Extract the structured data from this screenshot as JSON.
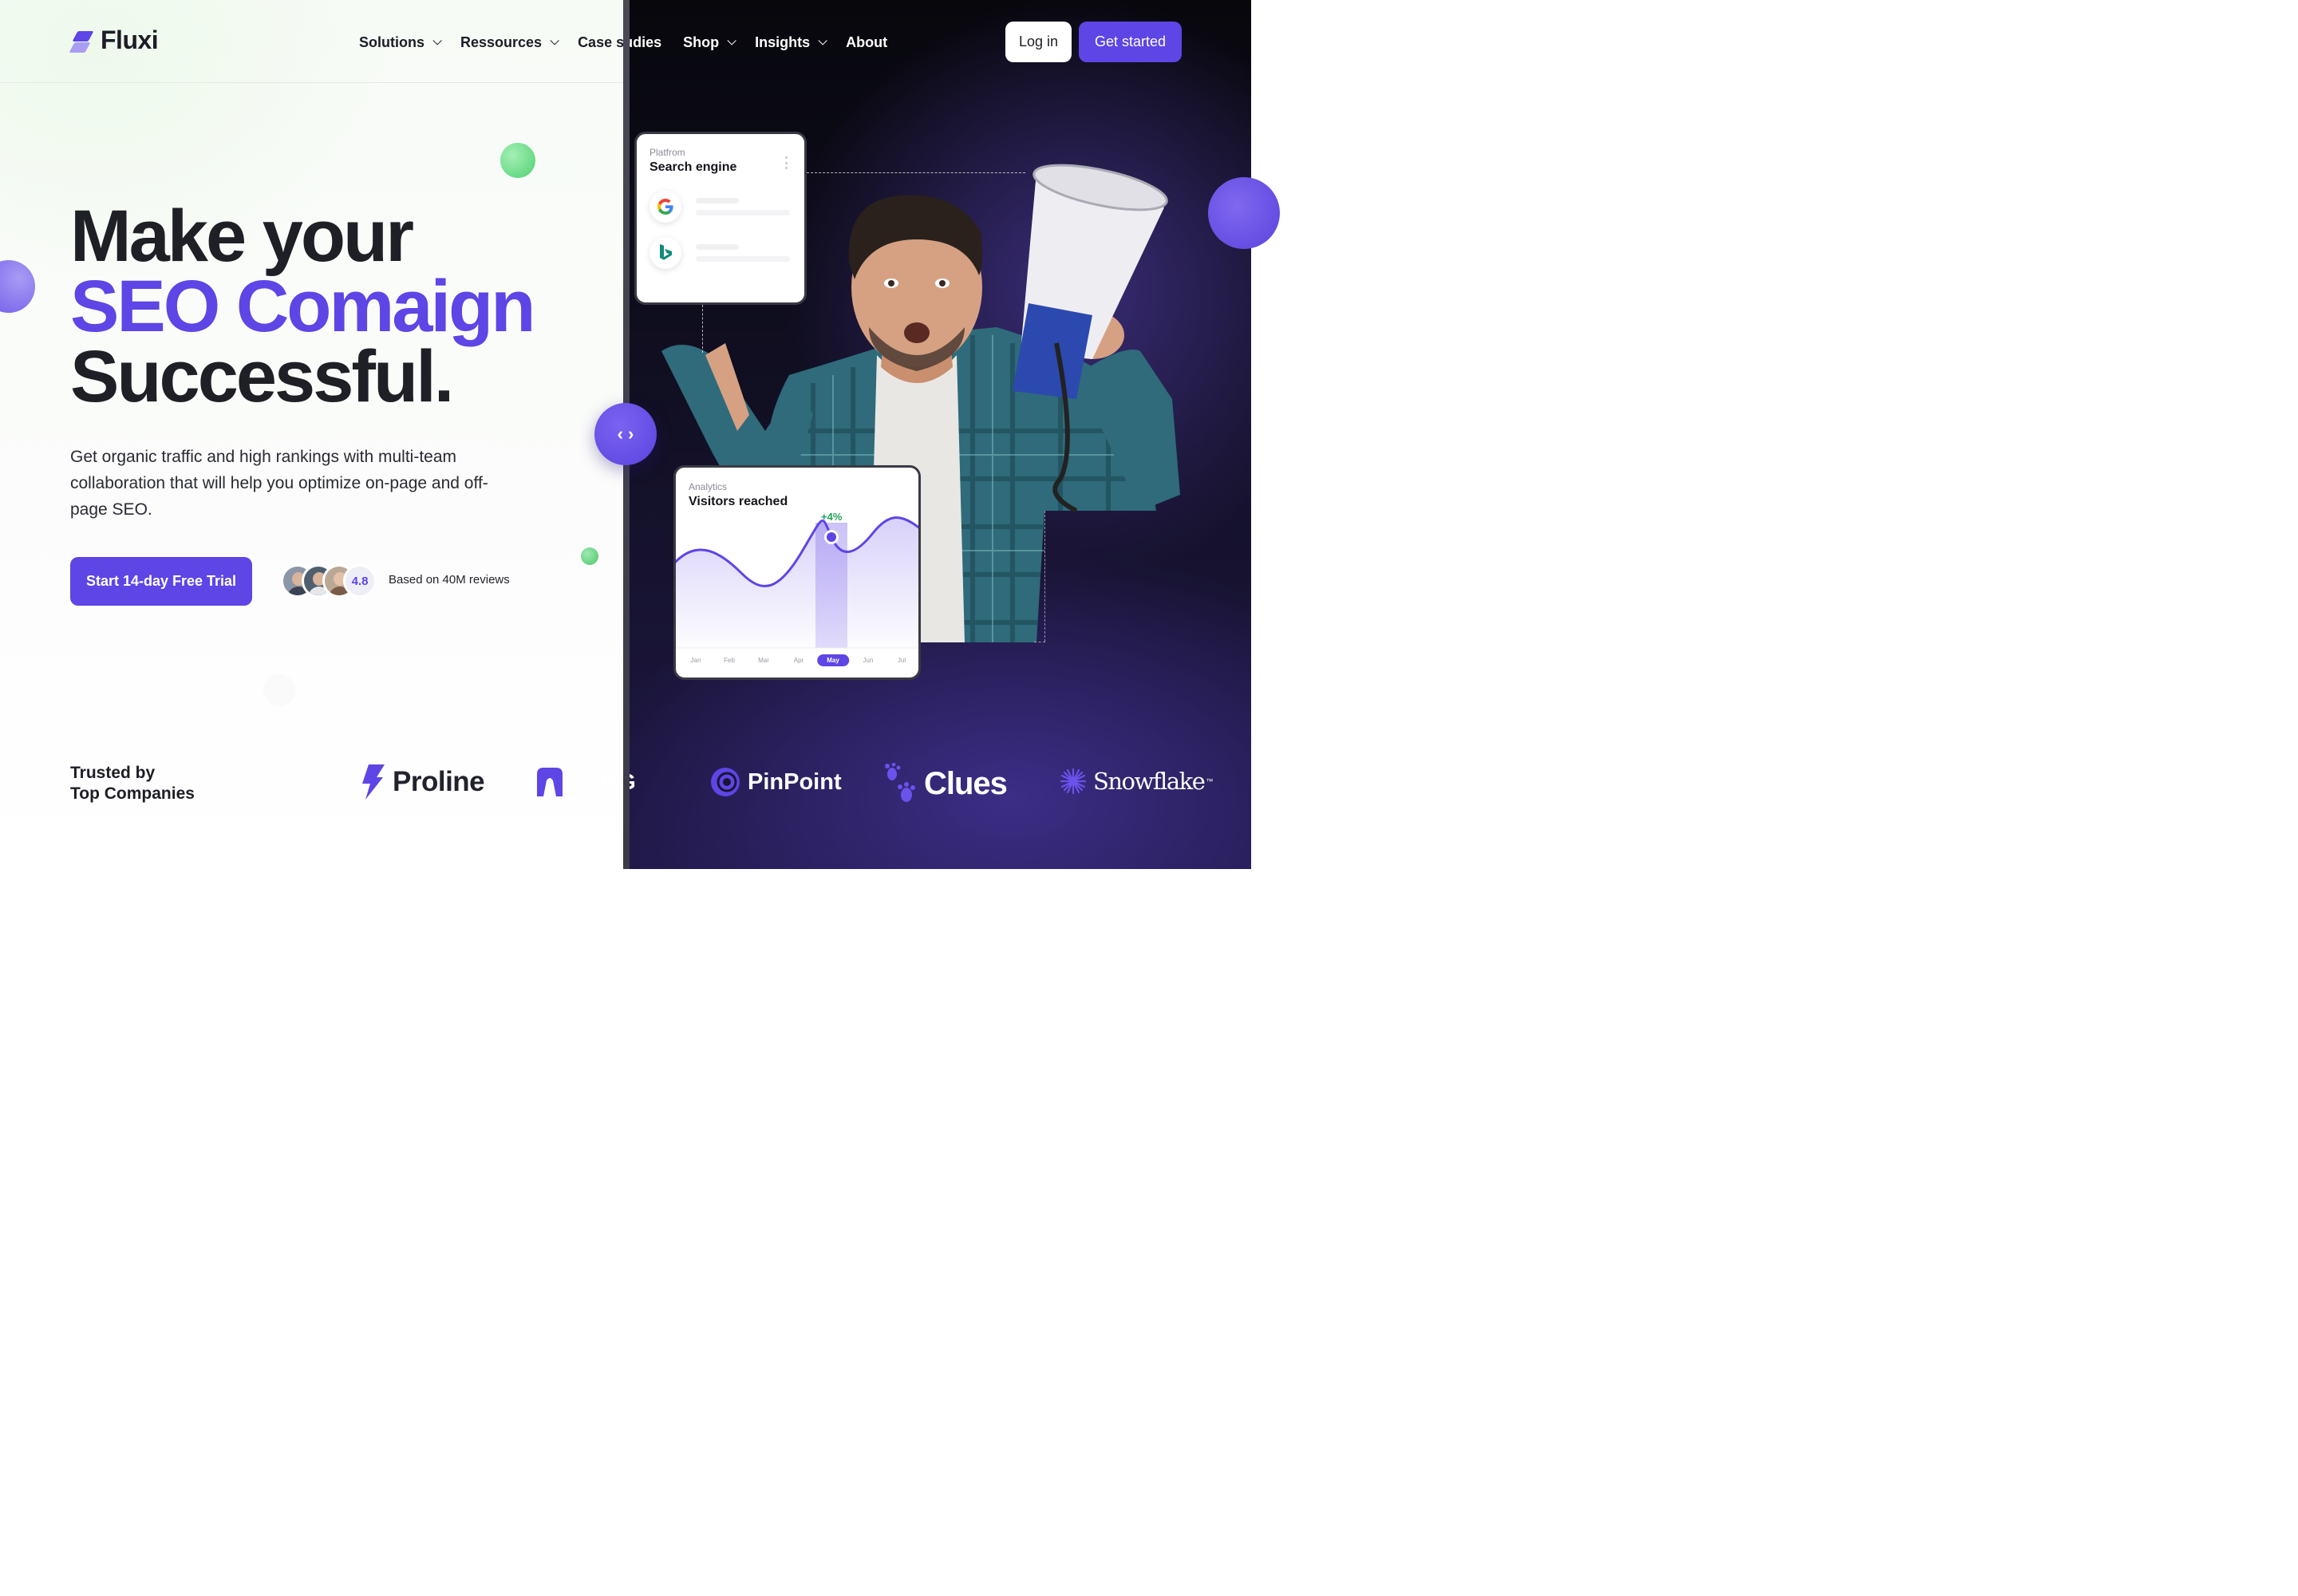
{
  "brand": {
    "name": "Fluxi",
    "accent": "#5d45e6"
  },
  "nav": {
    "items": [
      {
        "label": "Solutions",
        "has_dropdown": true
      },
      {
        "label": "Ressources",
        "has_dropdown": true
      },
      {
        "label": "Case studies",
        "label_dark_part": "Case s",
        "label_light_part": "udies",
        "has_dropdown": false
      },
      {
        "label": "Shop",
        "has_dropdown": true
      },
      {
        "label": "Insights",
        "has_dropdown": true
      },
      {
        "label": "About",
        "has_dropdown": false
      }
    ],
    "login_label": "Log in",
    "signup_label": "Get started"
  },
  "hero": {
    "line1": "Make your",
    "line2": "SEO Comaign",
    "line3": "Successful.",
    "subtext": "Get organic traffic and high rankings with multi-team collaboration that will help you optimize on-page and off-page SEO.",
    "cta_label": "Start 14-day Free Trial",
    "rating": "4.8",
    "reviews_text": "Based on 40M reviews"
  },
  "search_card": {
    "label": "Platfrom",
    "title": "Search engine",
    "engines": [
      "google-icon",
      "bing-icon"
    ]
  },
  "analytics_card": {
    "label": "Analytics",
    "title": "Visitors reached",
    "growth": "+4%",
    "months": [
      "Jan",
      "Feb",
      "Mar",
      "Apr",
      "May",
      "Jun",
      "Jul"
    ],
    "active_month": "May"
  },
  "slider_handle": {
    "glyph": "‹ ›"
  },
  "trusted": {
    "line1": "Trusted by",
    "line2": "Top Companies",
    "logos": [
      {
        "name": "Proline"
      },
      {
        "name_dark": "ORG",
        "name_light": "RG"
      },
      {
        "name": "PinPoint"
      },
      {
        "name": "Clues"
      },
      {
        "name": "Snowflake",
        "trademark": "™"
      }
    ]
  }
}
